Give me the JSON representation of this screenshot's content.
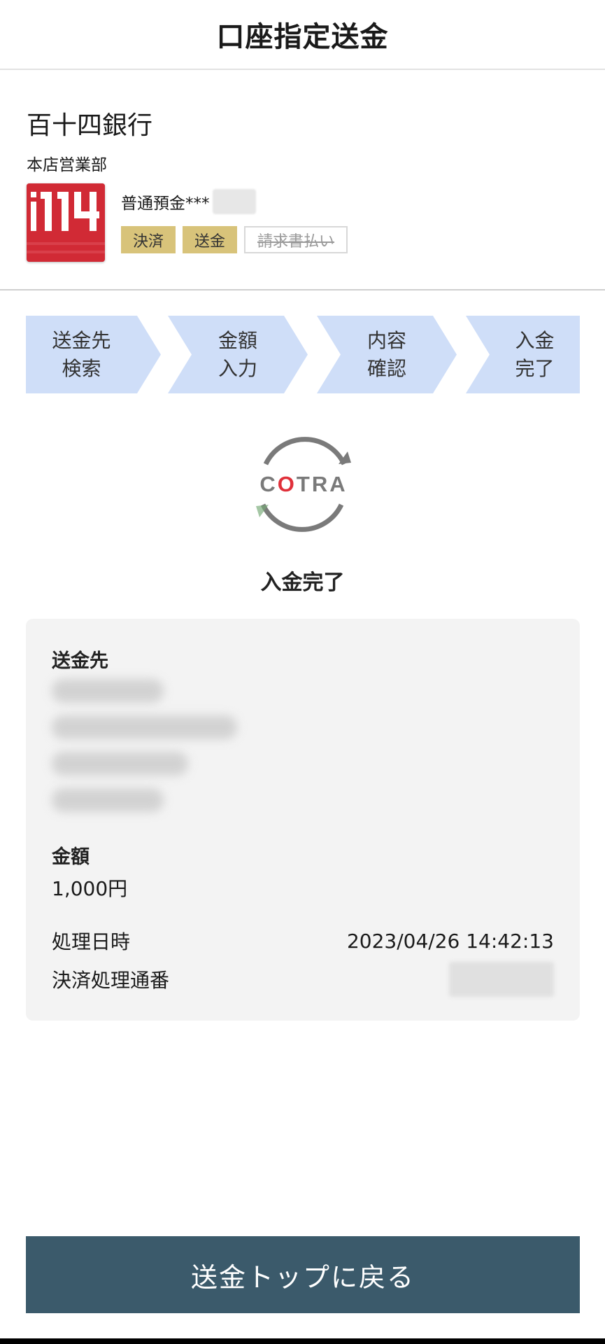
{
  "header": {
    "title": "口座指定送金"
  },
  "bank": {
    "name": "百十四銀行",
    "branch": "本店営業部",
    "logo_text": "114",
    "account": "普通預金***",
    "tags": [
      {
        "label": "決済",
        "state": "active"
      },
      {
        "label": "送金",
        "state": "active"
      },
      {
        "label": "請求書払い",
        "state": "disabled"
      }
    ]
  },
  "steps": [
    {
      "label": "送金先\n検索"
    },
    {
      "label": "金額\n入力"
    },
    {
      "label": "内容\n確認"
    },
    {
      "label": "入金\n完了"
    }
  ],
  "status": {
    "logo_text": "COTRA",
    "label": "入金完了"
  },
  "details": {
    "recipient_label": "送金先",
    "amount_label": "金額",
    "amount_value": "1,000円",
    "datetime_label": "処理日時",
    "datetime_value": "2023/04/26 14:42:13",
    "sequence_label": "決済処理通番"
  },
  "actions": {
    "back_label": "送金トップに戻る"
  },
  "colors": {
    "step_fill": "#cfdef8",
    "tag_active": "#d8c37a",
    "button": "#3b5a6b",
    "logo_red": "#d12a35"
  }
}
